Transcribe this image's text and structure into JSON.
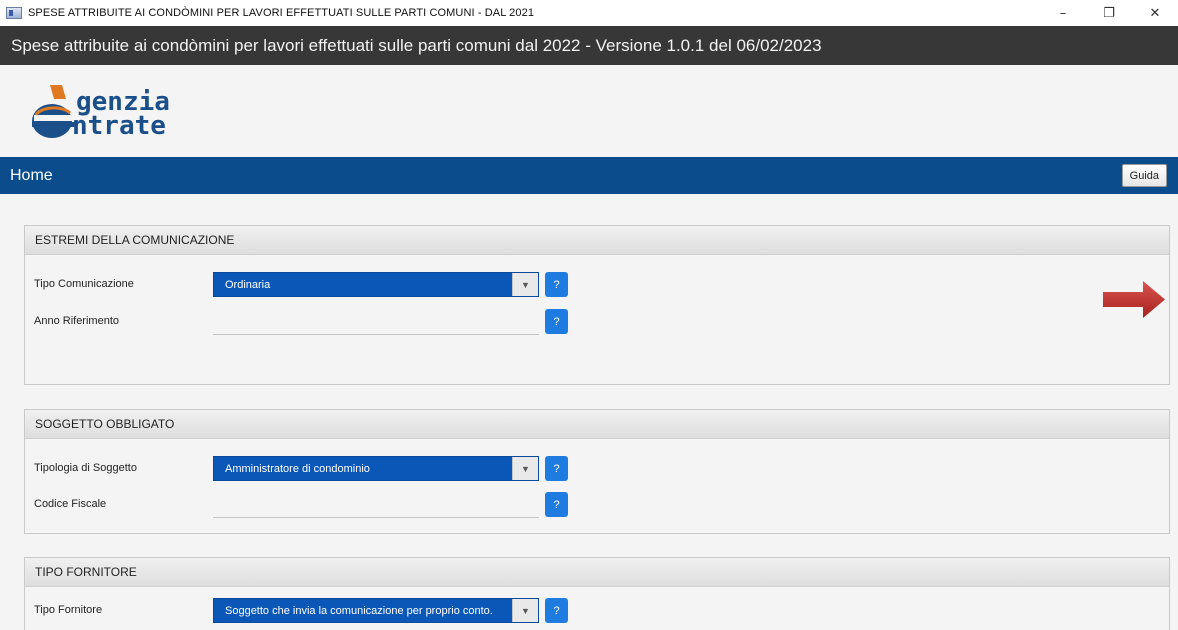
{
  "window": {
    "os_title": "SPESE ATTRIBUITE AI CONDÒMINI PER LAVORI EFFETTUATI SULLE PARTI COMUNI - DAL 2021",
    "controls": {
      "minimize": "–",
      "restore": "❐",
      "close": "✕"
    }
  },
  "app": {
    "header_title": "Spese attribuite ai condòmini per lavori effettuati sulle parti comuni dal 2022 - Versione 1.0.1 del 06/02/2023",
    "logo": {
      "line1": "genzia",
      "line2": "ntrate",
      "brand_colors": [
        "#1b4f8a",
        "#e07a22"
      ]
    }
  },
  "nav": {
    "title": "Home",
    "guida_label": "Guida"
  },
  "sections": {
    "estremi": {
      "title": "ESTREMI DELLA COMUNICAZIONE",
      "tipo_comunicazione": {
        "label": "Tipo Comunicazione",
        "value": "Ordinaria",
        "help": "?"
      },
      "anno_riferimento": {
        "label": "Anno Riferimento",
        "value": "",
        "help": "?"
      }
    },
    "soggetto": {
      "title": "SOGGETTO OBBLIGATO",
      "tipologia": {
        "label": "Tipologia di Soggetto",
        "value": "Amministratore di condominio",
        "help": "?"
      },
      "codice_fiscale": {
        "label": "Codice Fiscale",
        "value": "",
        "help": "?"
      }
    },
    "fornitore": {
      "title": "TIPO FORNITORE",
      "tipo_fornitore": {
        "label": "Tipo Fornitore",
        "value": "Soggetto che invia la comunicazione per proprio conto.",
        "help": "?"
      }
    }
  },
  "colors": {
    "header_bg": "#373737",
    "nav_bg": "#0a4c8c",
    "select_bg": "#0a57b8",
    "help_bg": "#1e7ce0",
    "arrow": "#c0392b"
  },
  "icons": {
    "dropdown": "▼"
  }
}
